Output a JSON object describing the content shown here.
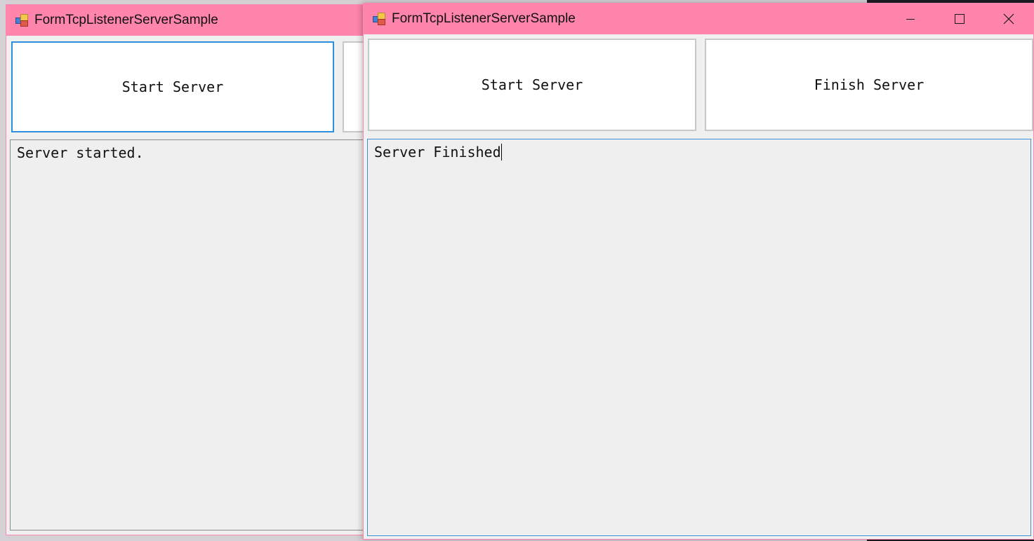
{
  "back_window": {
    "title": "FormTcpListenerServerSample",
    "start_button_label": "Start Server",
    "log_text": "Server started."
  },
  "front_window": {
    "title": "FormTcpListenerServerSample",
    "start_button_label": "Start Server",
    "finish_button_label": "Finish Server",
    "log_text": "Server Finished",
    "controls": {
      "minimize_icon": "minimize-icon",
      "maximize_icon": "maximize-icon",
      "close_icon": "close-icon"
    }
  },
  "colors": {
    "titlebar": "#ff85ad",
    "focus_border": "#2e8fde",
    "window_bg": "#f0f0f0"
  }
}
